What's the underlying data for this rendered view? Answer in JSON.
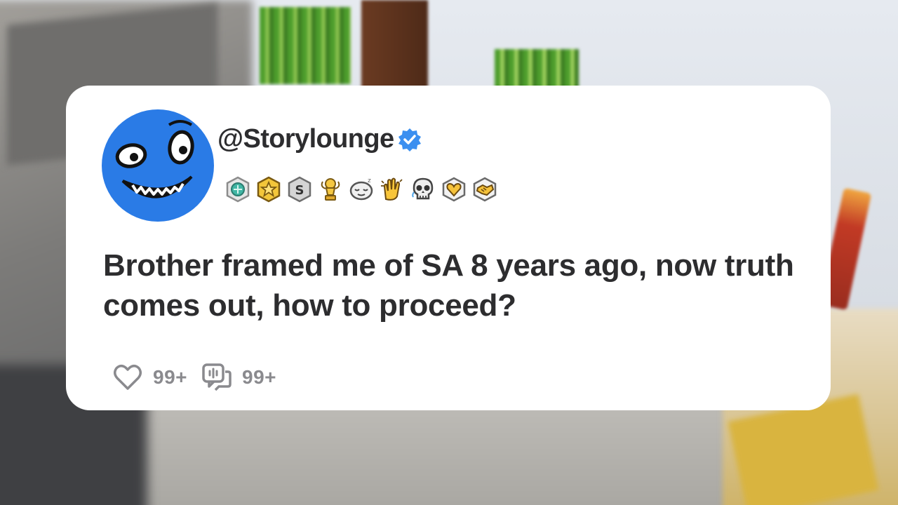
{
  "post": {
    "username": "@Storylounge",
    "verified": true,
    "title": "Brother framed me of SA 8 years ago, now truth comes out, how to proceed?",
    "likes": "99+",
    "comments": "99+"
  },
  "awards": [
    {
      "icon": "teal-gem-award-icon"
    },
    {
      "icon": "gold-star-award-icon"
    },
    {
      "icon": "silver-s-award-icon"
    },
    {
      "icon": "gold-trophy-award-icon"
    },
    {
      "icon": "sleepy-face-award-icon"
    },
    {
      "icon": "clapping-hands-award-icon"
    },
    {
      "icon": "skull-award-icon"
    },
    {
      "icon": "gold-heart-award-icon"
    },
    {
      "icon": "handshake-award-icon"
    }
  ],
  "colors": {
    "avatar_blue": "#2a7be6",
    "verified_blue": "#3b8ff0",
    "text_dark": "#2d2d2f",
    "stat_gray": "#8a8a8e"
  }
}
